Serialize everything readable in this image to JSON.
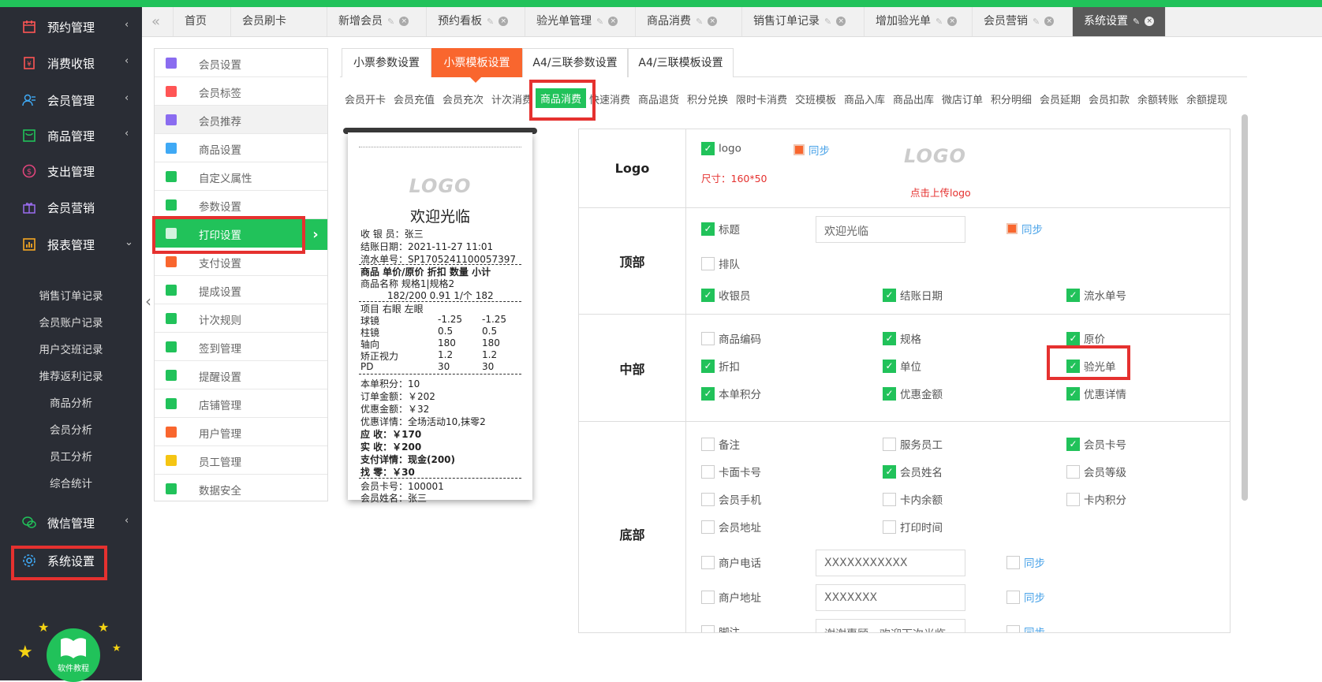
{
  "sidebar": {
    "items": [
      {
        "label": "预约管理",
        "icon": "calendar-icon"
      },
      {
        "label": "消费收银",
        "icon": "cashier-icon"
      },
      {
        "label": "会员管理",
        "icon": "users-icon"
      },
      {
        "label": "商品管理",
        "icon": "goods-icon"
      },
      {
        "label": "支出管理",
        "icon": "money-icon"
      },
      {
        "label": "会员营销",
        "icon": "gift-icon"
      },
      {
        "label": "报表管理",
        "icon": "chart-icon"
      }
    ],
    "report_sub": [
      "销售订单记录",
      "会员账户记录",
      "用户交班记录",
      "推荐返利记录",
      "商品分析",
      "会员分析",
      "员工分析",
      "综合统计"
    ],
    "wechat": {
      "label": "微信管理",
      "icon": "wechat-icon"
    },
    "settings": {
      "label": "系统设置",
      "icon": "gear-icon"
    },
    "tutorial_label": "软件教程"
  },
  "tabs": [
    {
      "label": "首页"
    },
    {
      "label": "会员刷卡"
    },
    {
      "label": "新增会员"
    },
    {
      "label": "预约看板"
    },
    {
      "label": "验光单管理"
    },
    {
      "label": "商品消费"
    },
    {
      "label": "销售订单记录"
    },
    {
      "label": "增加验光单"
    },
    {
      "label": "会员营销"
    },
    {
      "label": "系统设置"
    }
  ],
  "left_menu": [
    "会员设置",
    "会员标签",
    "会员推荐",
    "商品设置",
    "自定义属性",
    "参数设置",
    "打印设置",
    "支付设置",
    "提成设置",
    "计次规则",
    "签到管理",
    "提醒设置",
    "店铺管理",
    "用户管理",
    "员工管理",
    "数据安全"
  ],
  "print_tabs": [
    "小票参数设置",
    "小票模板设置",
    "A4/三联参数设置",
    "A4/三联模板设置"
  ],
  "categories": [
    "会员开卡",
    "会员充值",
    "会员充次",
    "计次消费",
    "商品消费",
    "快速消费",
    "商品退货",
    "积分兑换",
    "限时卡消费",
    "交班模板",
    "商品入库",
    "商品出库",
    "微店订单",
    "积分明细",
    "会员延期",
    "会员扣款",
    "余额转账",
    "余额提现"
  ],
  "receipt": {
    "logo": "LOGO",
    "welcome": "欢迎光临",
    "lines": {
      "cashier": "收 银 员：张三",
      "date": "结账日期：2021-11-27 11:01",
      "serial": "流水单号：SP1705241100057397",
      "item_header": "商品   单价/原价     折扣   数量   小计",
      "item_name": "商品名称 规格1|规格2",
      "item_vals": "182/200       0.91    1/个    182",
      "rx_header": "项目                 右眼          左眼",
      "rx": [
        {
          "k": "球镜",
          "r": "-1.25",
          "l": "-1.25"
        },
        {
          "k": "柱镜",
          "r": "0.5",
          "l": "0.5"
        },
        {
          "k": "轴向",
          "r": "180",
          "l": "180"
        },
        {
          "k": "矫正视力",
          "r": "1.2",
          "l": "1.2"
        },
        {
          "k": "PD",
          "r": "30",
          "l": "30"
        }
      ],
      "points": "本单积分：10",
      "order_amount": "订单金额：￥202",
      "discount_amount": "优惠金额：￥32",
      "discount_detail": "优惠详情：全场活动10,抹零2",
      "receivable": "应      收：￥170",
      "received": "实      收：￥200",
      "pay_detail": "支付详情：现金(200)",
      "change": "找      零：￥30",
      "card_no": "会员卡号：100001",
      "member_name": "会员姓名：张三"
    }
  },
  "panel": {
    "logo_section": {
      "title": "Logo",
      "logo_cb": "logo",
      "sync": "同步",
      "size_note": "尺寸：160*50",
      "logo_preview": "LOGO",
      "upload_hint": "点击上传logo"
    },
    "top_section": {
      "title": "顶部",
      "title_cb": "标题",
      "title_value": "欢迎光临",
      "sync": "同步",
      "queue": "排队",
      "cashier": "收银员",
      "date": "结账日期",
      "serial": "流水单号"
    },
    "middle_section": {
      "title": "中部",
      "items": [
        "商品编码",
        "规格",
        "原价",
        "折扣",
        "单位",
        "验光单",
        "本单积分",
        "优惠金额",
        "优惠详情"
      ]
    },
    "bottom_section": {
      "title": "底部",
      "items": [
        "备注",
        "服务员工",
        "会员卡号",
        "卡面卡号",
        "会员姓名",
        "会员等级",
        "会员手机",
        "卡内余额",
        "卡内积分",
        "会员地址",
        "打印时间"
      ],
      "phone": "商户电话",
      "phone_value": "XXXXXXXXXXX",
      "address": "商户地址",
      "address_value": "XXXXXXX",
      "footer": "脚注",
      "footer_value": "谢谢惠顾，欢迎下次光临",
      "sync": "同步"
    }
  },
  "colors": {
    "accent": "#21c25a",
    "orange": "#f9662e",
    "highlight": "#e5312f",
    "sidebar": "#2a2d35"
  }
}
